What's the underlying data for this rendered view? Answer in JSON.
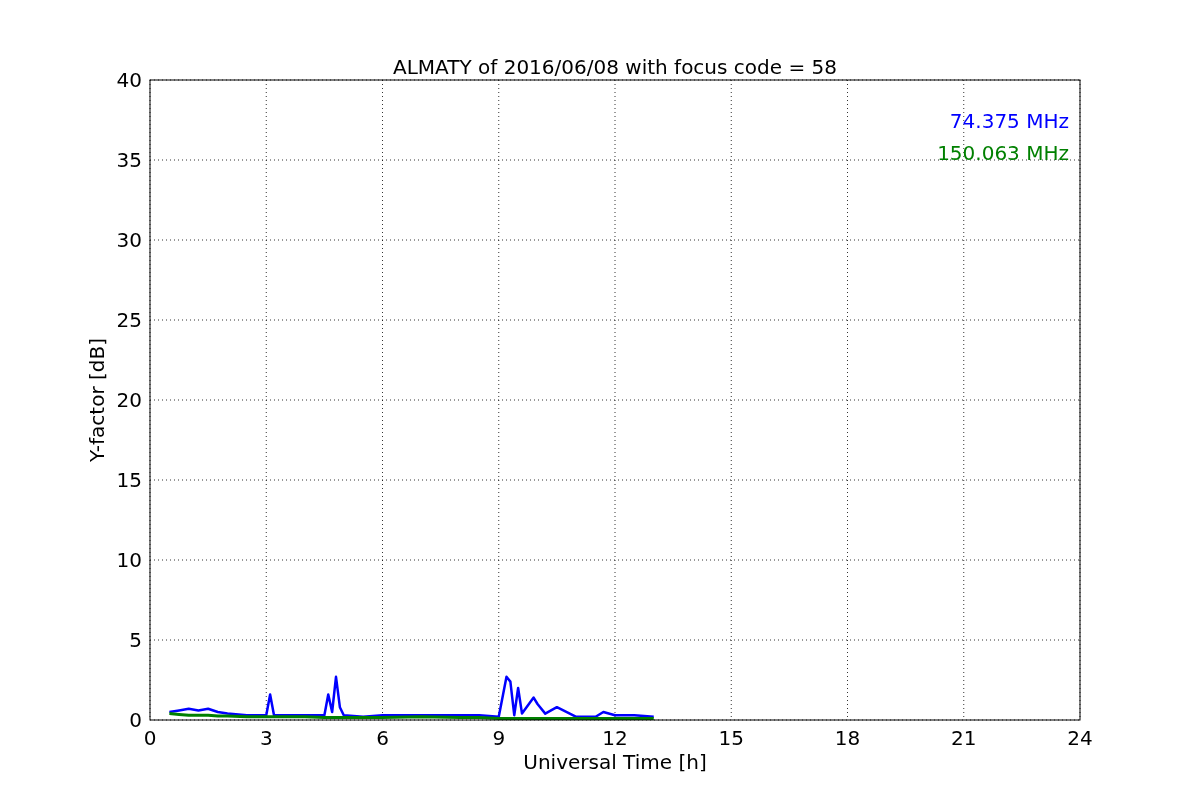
{
  "figure": {
    "chart_data": {
      "type": "line",
      "title": "ALMATY of 2016/06/08 with focus code = 58",
      "xlabel": "Universal Time [h]",
      "ylabel": "Y-factor [dB]",
      "x": [
        0.5,
        0.75,
        1.0,
        1.25,
        1.5,
        1.75,
        2.0,
        2.5,
        3.0,
        3.1,
        3.2,
        3.5,
        4.0,
        4.5,
        4.6,
        4.7,
        4.8,
        4.9,
        5.0,
        5.5,
        6.0,
        7.0,
        8.0,
        8.5,
        9.0,
        9.2,
        9.3,
        9.4,
        9.5,
        9.6,
        9.9,
        10.0,
        10.2,
        10.5,
        11.0,
        11.5,
        11.7,
        12.0,
        12.5,
        13.0
      ],
      "series": [
        {
          "name": "74.375 MHz",
          "color": "#0000ff",
          "values": [
            0.5,
            0.6,
            0.7,
            0.6,
            0.7,
            0.5,
            0.4,
            0.3,
            0.3,
            1.6,
            0.3,
            0.3,
            0.3,
            0.3,
            1.6,
            0.5,
            2.7,
            0.8,
            0.3,
            0.2,
            0.3,
            0.3,
            0.3,
            0.3,
            0.2,
            2.7,
            2.4,
            0.3,
            2.0,
            0.4,
            1.4,
            1.0,
            0.4,
            0.8,
            0.2,
            0.2,
            0.5,
            0.3,
            0.3,
            0.2
          ]
        },
        {
          "name": "150.063 MHz",
          "color": "#008000",
          "values": [
            0.4,
            0.35,
            0.3,
            0.3,
            0.3,
            0.25,
            0.25,
            0.2,
            0.2,
            0.2,
            0.2,
            0.2,
            0.2,
            0.15,
            0.15,
            0.15,
            0.15,
            0.15,
            0.15,
            0.15,
            0.15,
            0.2,
            0.15,
            0.15,
            0.1,
            0.1,
            0.1,
            0.1,
            0.1,
            0.1,
            0.1,
            0.1,
            0.1,
            0.1,
            0.1,
            0.1,
            0.1,
            0.1,
            0.1,
            0.1
          ]
        }
      ],
      "xlim": [
        0,
        24
      ],
      "ylim": [
        0,
        40
      ],
      "xticks": [
        0,
        3,
        6,
        9,
        12,
        15,
        18,
        21,
        24
      ],
      "yticks": [
        0,
        5,
        10,
        15,
        20,
        25,
        30,
        35,
        40
      ],
      "grid": true
    }
  }
}
